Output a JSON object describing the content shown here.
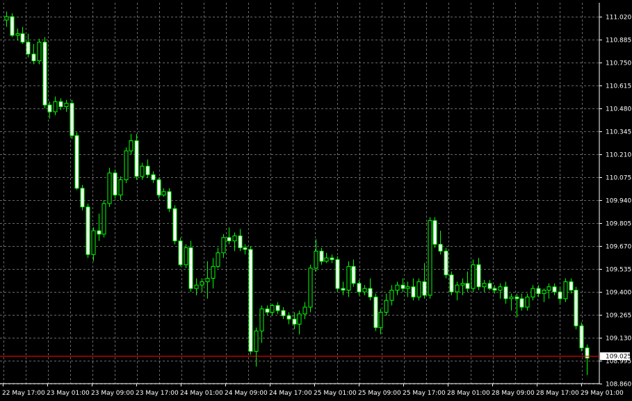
{
  "chart_data": {
    "type": "candlestick",
    "title": "",
    "xlabel": "",
    "ylabel": "",
    "ylim": [
      108.86,
      111.1
    ],
    "grid": true,
    "y_ticks": [
      "111.020",
      "110.885",
      "110.750",
      "110.615",
      "110.480",
      "110.345",
      "110.210",
      "110.075",
      "109.940",
      "109.805",
      "109.670",
      "109.535",
      "109.400",
      "109.265",
      "109.130",
      "108.995",
      "108.860"
    ],
    "x_ticks": [
      "22 May 17:00",
      "23 May 01:00",
      "23 May 09:00",
      "23 May 17:00",
      "24 May 01:00",
      "24 May 09:00",
      "24 May 17:00",
      "25 May 01:00",
      "25 May 09:00",
      "25 May 17:00",
      "28 May 01:00",
      "28 May 09:00",
      "28 May 17:00",
      "29 May 01:00"
    ],
    "current_price": "109.025",
    "current_price_value": 109.025,
    "colors": {
      "background": "#000000",
      "candle": "#00ff00",
      "bull_body": "#000000",
      "bear_body": "#ffffff",
      "grid": "#6a6a6a",
      "price_line": "#ff0000",
      "text": "#ffffff"
    },
    "candles": [
      {
        "o": 111.0,
        "h": 111.05,
        "l": 110.96,
        "c": 111.02
      },
      {
        "o": 111.02,
        "h": 111.04,
        "l": 110.9,
        "c": 110.91
      },
      {
        "o": 110.91,
        "h": 110.95,
        "l": 110.88,
        "c": 110.92
      },
      {
        "o": 110.92,
        "h": 110.96,
        "l": 110.86,
        "c": 110.87
      },
      {
        "o": 110.87,
        "h": 110.92,
        "l": 110.78,
        "c": 110.8
      },
      {
        "o": 110.8,
        "h": 110.86,
        "l": 110.74,
        "c": 110.76
      },
      {
        "o": 110.76,
        "h": 110.89,
        "l": 110.74,
        "c": 110.87
      },
      {
        "o": 110.87,
        "h": 110.9,
        "l": 110.48,
        "c": 110.5
      },
      {
        "o": 110.5,
        "h": 110.52,
        "l": 110.42,
        "c": 110.46
      },
      {
        "o": 110.46,
        "h": 110.55,
        "l": 110.44,
        "c": 110.52
      },
      {
        "o": 110.52,
        "h": 110.54,
        "l": 110.47,
        "c": 110.49
      },
      {
        "o": 110.49,
        "h": 110.53,
        "l": 110.46,
        "c": 110.51
      },
      {
        "o": 110.51,
        "h": 110.53,
        "l": 110.3,
        "c": 110.32
      },
      {
        "o": 110.32,
        "h": 110.34,
        "l": 110.0,
        "c": 110.01
      },
      {
        "o": 110.01,
        "h": 110.03,
        "l": 109.88,
        "c": 109.9
      },
      {
        "o": 109.9,
        "h": 109.92,
        "l": 109.6,
        "c": 109.62
      },
      {
        "o": 109.62,
        "h": 109.78,
        "l": 109.58,
        "c": 109.76
      },
      {
        "o": 109.76,
        "h": 109.86,
        "l": 109.7,
        "c": 109.74
      },
      {
        "o": 109.74,
        "h": 109.94,
        "l": 109.72,
        "c": 109.92
      },
      {
        "o": 109.92,
        "h": 110.13,
        "l": 109.9,
        "c": 110.1
      },
      {
        "o": 110.1,
        "h": 110.12,
        "l": 109.95,
        "c": 109.97
      },
      {
        "o": 109.97,
        "h": 110.08,
        "l": 109.94,
        "c": 110.06
      },
      {
        "o": 110.06,
        "h": 110.25,
        "l": 110.04,
        "c": 110.23
      },
      {
        "o": 110.23,
        "h": 110.33,
        "l": 110.21,
        "c": 110.29
      },
      {
        "o": 110.29,
        "h": 110.33,
        "l": 110.06,
        "c": 110.08
      },
      {
        "o": 110.08,
        "h": 110.16,
        "l": 110.06,
        "c": 110.14
      },
      {
        "o": 110.14,
        "h": 110.18,
        "l": 110.07,
        "c": 110.09
      },
      {
        "o": 110.09,
        "h": 110.11,
        "l": 110.04,
        "c": 110.06
      },
      {
        "o": 110.06,
        "h": 110.07,
        "l": 109.95,
        "c": 109.97
      },
      {
        "o": 109.97,
        "h": 110.01,
        "l": 109.96,
        "c": 109.99
      },
      {
        "o": 109.99,
        "h": 110.01,
        "l": 109.87,
        "c": 109.89
      },
      {
        "o": 109.89,
        "h": 109.91,
        "l": 109.68,
        "c": 109.7
      },
      {
        "o": 109.7,
        "h": 109.72,
        "l": 109.55,
        "c": 109.56
      },
      {
        "o": 109.56,
        "h": 109.68,
        "l": 109.54,
        "c": 109.66
      },
      {
        "o": 109.66,
        "h": 109.7,
        "l": 109.4,
        "c": 109.42
      },
      {
        "o": 109.42,
        "h": 109.48,
        "l": 109.38,
        "c": 109.44
      },
      {
        "o": 109.44,
        "h": 109.48,
        "l": 109.4,
        "c": 109.46
      },
      {
        "o": 109.46,
        "h": 109.58,
        "l": 109.36,
        "c": 109.48
      },
      {
        "o": 109.48,
        "h": 109.6,
        "l": 109.42,
        "c": 109.55
      },
      {
        "o": 109.55,
        "h": 109.66,
        "l": 109.54,
        "c": 109.63
      },
      {
        "o": 109.63,
        "h": 109.74,
        "l": 109.6,
        "c": 109.72
      },
      {
        "o": 109.72,
        "h": 109.78,
        "l": 109.68,
        "c": 109.7
      },
      {
        "o": 109.7,
        "h": 109.75,
        "l": 109.64,
        "c": 109.73
      },
      {
        "o": 109.73,
        "h": 109.77,
        "l": 109.64,
        "c": 109.66
      },
      {
        "o": 109.66,
        "h": 109.68,
        "l": 109.62,
        "c": 109.65
      },
      {
        "o": 109.65,
        "h": 109.67,
        "l": 109.03,
        "c": 109.05
      },
      {
        "o": 109.05,
        "h": 109.19,
        "l": 108.96,
        "c": 109.17
      },
      {
        "o": 109.17,
        "h": 109.32,
        "l": 109.1,
        "c": 109.3
      },
      {
        "o": 109.3,
        "h": 109.32,
        "l": 109.26,
        "c": 109.28
      },
      {
        "o": 109.28,
        "h": 109.33,
        "l": 109.26,
        "c": 109.32
      },
      {
        "o": 109.32,
        "h": 109.34,
        "l": 109.27,
        "c": 109.29
      },
      {
        "o": 109.29,
        "h": 109.31,
        "l": 109.24,
        "c": 109.26
      },
      {
        "o": 109.26,
        "h": 109.28,
        "l": 109.21,
        "c": 109.24
      },
      {
        "o": 109.24,
        "h": 109.28,
        "l": 109.18,
        "c": 109.21
      },
      {
        "o": 109.21,
        "h": 109.29,
        "l": 109.15,
        "c": 109.27
      },
      {
        "o": 109.27,
        "h": 109.34,
        "l": 109.24,
        "c": 109.31
      },
      {
        "o": 109.31,
        "h": 109.56,
        "l": 109.28,
        "c": 109.54
      },
      {
        "o": 109.54,
        "h": 109.71,
        "l": 109.52,
        "c": 109.64
      },
      {
        "o": 109.64,
        "h": 109.66,
        "l": 109.56,
        "c": 109.58
      },
      {
        "o": 109.58,
        "h": 109.63,
        "l": 109.57,
        "c": 109.6
      },
      {
        "o": 109.6,
        "h": 109.62,
        "l": 109.57,
        "c": 109.59
      },
      {
        "o": 109.59,
        "h": 109.61,
        "l": 109.4,
        "c": 109.42
      },
      {
        "o": 109.42,
        "h": 109.46,
        "l": 109.38,
        "c": 109.41
      },
      {
        "o": 109.41,
        "h": 109.58,
        "l": 109.37,
        "c": 109.55
      },
      {
        "o": 109.55,
        "h": 109.59,
        "l": 109.43,
        "c": 109.45
      },
      {
        "o": 109.45,
        "h": 109.47,
        "l": 109.38,
        "c": 109.4
      },
      {
        "o": 109.4,
        "h": 109.44,
        "l": 109.38,
        "c": 109.42
      },
      {
        "o": 109.42,
        "h": 109.48,
        "l": 109.35,
        "c": 109.37
      },
      {
        "o": 109.37,
        "h": 109.39,
        "l": 109.17,
        "c": 109.19
      },
      {
        "o": 109.19,
        "h": 109.3,
        "l": 109.15,
        "c": 109.28
      },
      {
        "o": 109.28,
        "h": 109.39,
        "l": 109.26,
        "c": 109.35
      },
      {
        "o": 109.35,
        "h": 109.44,
        "l": 109.32,
        "c": 109.41
      },
      {
        "o": 109.41,
        "h": 109.46,
        "l": 109.38,
        "c": 109.44
      },
      {
        "o": 109.44,
        "h": 109.48,
        "l": 109.4,
        "c": 109.42
      },
      {
        "o": 109.42,
        "h": 109.46,
        "l": 109.37,
        "c": 109.43
      },
      {
        "o": 109.43,
        "h": 109.48,
        "l": 109.35,
        "c": 109.37
      },
      {
        "o": 109.37,
        "h": 109.48,
        "l": 109.35,
        "c": 109.46
      },
      {
        "o": 109.46,
        "h": 109.57,
        "l": 109.36,
        "c": 109.38
      },
      {
        "o": 109.38,
        "h": 109.84,
        "l": 109.36,
        "c": 109.82
      },
      {
        "o": 109.82,
        "h": 109.84,
        "l": 109.66,
        "c": 109.68
      },
      {
        "o": 109.68,
        "h": 109.76,
        "l": 109.62,
        "c": 109.64
      },
      {
        "o": 109.64,
        "h": 109.66,
        "l": 109.48,
        "c": 109.5
      },
      {
        "o": 109.5,
        "h": 109.52,
        "l": 109.38,
        "c": 109.4
      },
      {
        "o": 109.4,
        "h": 109.46,
        "l": 109.35,
        "c": 109.44
      },
      {
        "o": 109.44,
        "h": 109.48,
        "l": 109.38,
        "c": 109.45
      },
      {
        "o": 109.45,
        "h": 109.52,
        "l": 109.4,
        "c": 109.42
      },
      {
        "o": 109.42,
        "h": 109.59,
        "l": 109.4,
        "c": 109.56
      },
      {
        "o": 109.56,
        "h": 109.6,
        "l": 109.41,
        "c": 109.43
      },
      {
        "o": 109.43,
        "h": 109.47,
        "l": 109.4,
        "c": 109.45
      },
      {
        "o": 109.45,
        "h": 109.47,
        "l": 109.41,
        "c": 109.42
      },
      {
        "o": 109.42,
        "h": 109.44,
        "l": 109.39,
        "c": 109.41
      },
      {
        "o": 109.41,
        "h": 109.45,
        "l": 109.36,
        "c": 109.43
      },
      {
        "o": 109.43,
        "h": 109.46,
        "l": 109.33,
        "c": 109.36
      },
      {
        "o": 109.36,
        "h": 109.39,
        "l": 109.29,
        "c": 109.37
      },
      {
        "o": 109.37,
        "h": 109.39,
        "l": 109.25,
        "c": 109.36
      },
      {
        "o": 109.36,
        "h": 109.39,
        "l": 109.29,
        "c": 109.31
      },
      {
        "o": 109.31,
        "h": 109.39,
        "l": 109.29,
        "c": 109.37
      },
      {
        "o": 109.37,
        "h": 109.44,
        "l": 109.35,
        "c": 109.42
      },
      {
        "o": 109.42,
        "h": 109.44,
        "l": 109.37,
        "c": 109.39
      },
      {
        "o": 109.39,
        "h": 109.42,
        "l": 109.34,
        "c": 109.41
      },
      {
        "o": 109.41,
        "h": 109.45,
        "l": 109.36,
        "c": 109.43
      },
      {
        "o": 109.43,
        "h": 109.45,
        "l": 109.38,
        "c": 109.4
      },
      {
        "o": 109.4,
        "h": 109.43,
        "l": 109.33,
        "c": 109.36
      },
      {
        "o": 109.36,
        "h": 109.48,
        "l": 109.34,
        "c": 109.46
      },
      {
        "o": 109.46,
        "h": 109.48,
        "l": 109.39,
        "c": 109.41
      },
      {
        "o": 109.41,
        "h": 109.43,
        "l": 109.18,
        "c": 109.2
      },
      {
        "o": 109.2,
        "h": 109.22,
        "l": 109.05,
        "c": 109.07
      },
      {
        "o": 109.07,
        "h": 109.09,
        "l": 108.91,
        "c": 109.01
      }
    ]
  }
}
